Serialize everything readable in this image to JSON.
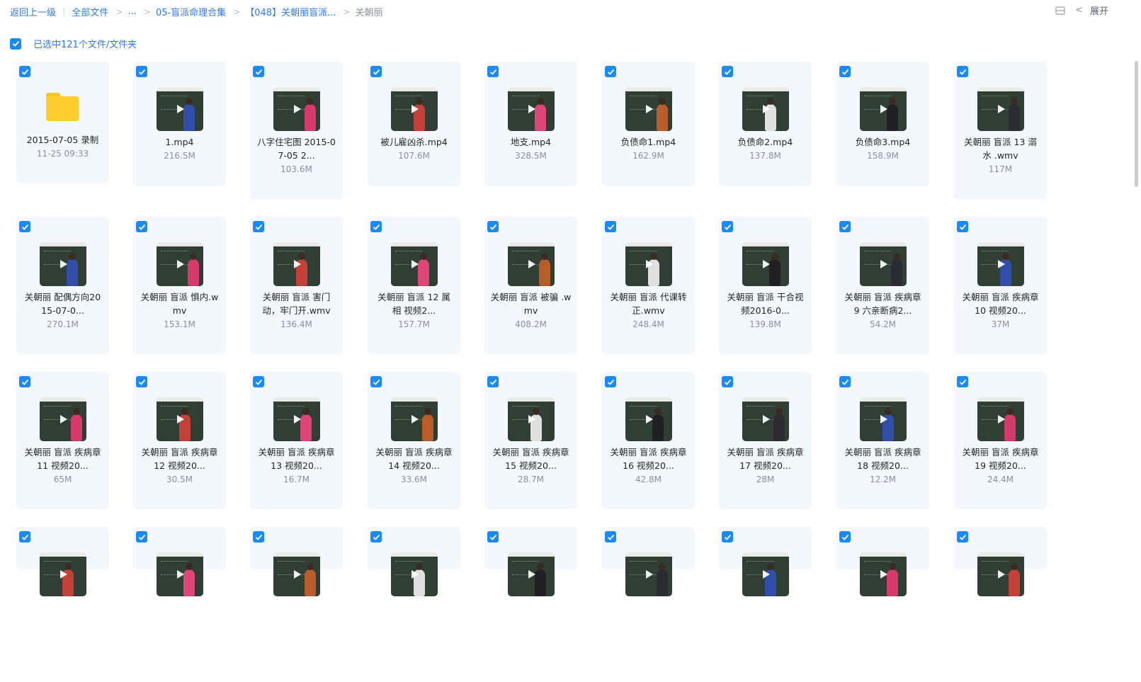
{
  "breadcrumb": {
    "back": "返回上一级",
    "all_files": "全部文件",
    "ellipsis": "...",
    "folder1": "05-盲派命理合集",
    "folder2": "【048】关朝丽盲派...",
    "current": "关朝丽"
  },
  "toolbar": {
    "expand_label": "展开"
  },
  "selection": {
    "text": "已选中121个文件/文件夹"
  },
  "colors": {
    "accent": "#1c8af5",
    "card_bg": "#f2f8fe",
    "link": "#2f7be6"
  },
  "files": [
    [
      {
        "name": "2015-07-05 录制",
        "meta": "11-25 09:33",
        "type": "folder"
      },
      {
        "name": "1.mp4",
        "meta": "216.5M",
        "type": "video"
      },
      {
        "name": "八字住宅图 2015-07-05 2...",
        "meta": "103.6M",
        "type": "video"
      },
      {
        "name": "被儿雇凶杀.mp4",
        "meta": "107.6M",
        "type": "video"
      },
      {
        "name": "地支.mp4",
        "meta": "328.5M",
        "type": "video"
      },
      {
        "name": "负债命1.mp4",
        "meta": "162.9M",
        "type": "video"
      },
      {
        "name": "负债命2.mp4",
        "meta": "137.8M",
        "type": "video"
      },
      {
        "name": "负债命3.mp4",
        "meta": "158.9M",
        "type": "video"
      },
      {
        "name": "关朝丽 盲派 13 溺水 .wmv",
        "meta": "117M",
        "type": "video"
      }
    ],
    [
      {
        "name": "关朝丽 配偶方向2015-07-0...",
        "meta": "270.1M",
        "type": "video"
      },
      {
        "name": "关朝丽 盲派 惧内.wmv",
        "meta": "153.1M",
        "type": "video"
      },
      {
        "name": "关朝丽 盲派 害门动，牢门开.wmv",
        "meta": "136.4M",
        "type": "video"
      },
      {
        "name": "关朝丽 盲派 12 属相 视频2...",
        "meta": "157.7M",
        "type": "video"
      },
      {
        "name": "关朝丽 盲派 被骗 .wmv",
        "meta": "408.2M",
        "type": "video"
      },
      {
        "name": "关朝丽 盲派 代课转正.wmv",
        "meta": "248.4M",
        "type": "video"
      },
      {
        "name": "关朝丽 盲派 干合视频2016-0...",
        "meta": "139.8M",
        "type": "video"
      },
      {
        "name": "关朝丽 盲派 疾病章 9 六亲断病2...",
        "meta": "54.2M",
        "type": "video"
      },
      {
        "name": "关朝丽 盲派 疾病章 10 视频20...",
        "meta": "37M",
        "type": "video"
      }
    ],
    [
      {
        "name": "关朝丽 盲派 疾病章 11 视频20...",
        "meta": "65M",
        "type": "video"
      },
      {
        "name": "关朝丽 盲派 疾病章 12 视频20...",
        "meta": "30.5M",
        "type": "video"
      },
      {
        "name": "关朝丽 盲派 疾病章 13 视频20...",
        "meta": "16.7M",
        "type": "video"
      },
      {
        "name": "关朝丽 盲派 疾病章 14 视频20...",
        "meta": "33.6M",
        "type": "video"
      },
      {
        "name": "关朝丽 盲派 疾病章 15 视频20...",
        "meta": "28.7M",
        "type": "video"
      },
      {
        "name": "关朝丽 盲派 疾病章 16 视频20...",
        "meta": "42.8M",
        "type": "video"
      },
      {
        "name": "关朝丽 盲派 疾病章 17 视频20...",
        "meta": "28M",
        "type": "video"
      },
      {
        "name": "关朝丽 盲派 疾病章 18 视频20...",
        "meta": "12.2M",
        "type": "video"
      },
      {
        "name": "关朝丽 盲派 疾病章 19 视频20...",
        "meta": "24.4M",
        "type": "video"
      }
    ],
    [
      {
        "name": "",
        "meta": "",
        "type": "video"
      },
      {
        "name": "",
        "meta": "",
        "type": "video"
      },
      {
        "name": "",
        "meta": "",
        "type": "video"
      },
      {
        "name": "",
        "meta": "",
        "type": "video"
      },
      {
        "name": "",
        "meta": "",
        "type": "video"
      },
      {
        "name": "",
        "meta": "",
        "type": "video"
      },
      {
        "name": "",
        "meta": "",
        "type": "video"
      },
      {
        "name": "",
        "meta": "",
        "type": "video"
      },
      {
        "name": "",
        "meta": "",
        "type": "video"
      }
    ]
  ]
}
